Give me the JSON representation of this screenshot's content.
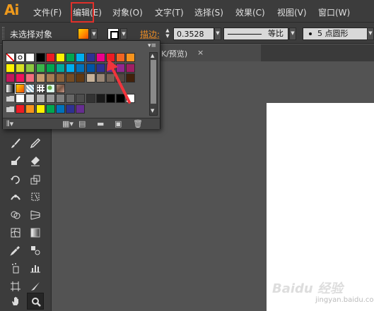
{
  "app": {
    "logo": "Ai"
  },
  "menu": [
    {
      "label": "文件(F)"
    },
    {
      "label": "编辑(E)"
    },
    {
      "label": "对象(O)"
    },
    {
      "label": "文字(T)"
    },
    {
      "label": "选择(S)"
    },
    {
      "label": "效果(C)"
    },
    {
      "label": "视图(V)"
    },
    {
      "label": "窗口(W)"
    }
  ],
  "control": {
    "selection_status": "未选择对象",
    "stroke_label": "描边:",
    "stroke_weight": "0.3528",
    "profile_label": "等比",
    "brush_label": "5 点圆形"
  },
  "document": {
    "tab_label": "K/预览)",
    "close_glyph": "×"
  },
  "swatches": {
    "rows": [
      [
        "none",
        "registration",
        "#ffffff",
        "#000000",
        "#ed1c24",
        "#fff200",
        "#00a651",
        "#00aeef",
        "#2e3192",
        "#ec008c",
        "#ed1c24",
        "#f26522",
        "#f7941d"
      ],
      [
        "#fff200",
        "#d7df23",
        "#8dc63f",
        "#39b54a",
        "#00a651",
        "#00a99d",
        "#00aeef",
        "#0072bc",
        "#0054a6",
        "#2e3192",
        "#662d91",
        "#92278f",
        "#9e1f63"
      ],
      [
        "#c2185b",
        "#ed145b",
        "#f26d7d",
        "#c69c6d",
        "#a67c52",
        "#8c6239",
        "#754c24",
        "#603913",
        "#c7b299",
        "#998675",
        "#736357",
        "#534741",
        "#42210b"
      ],
      [
        "gradient-gray",
        "gradient-orange",
        "pattern-check",
        "pattern-dots",
        "pattern-leaf",
        "pattern-texture"
      ],
      [
        "folder",
        "#ffffff",
        "#d9d9d9",
        "#b3b3b3",
        "#999999",
        "#808080",
        "#666666",
        "#4d4d4d",
        "#333333",
        "#1a1a1a",
        "#000000",
        "#000000",
        "#ffffff"
      ],
      [
        "folder",
        "#ed1c24",
        "#f7941d",
        "#fff200",
        "#00a651",
        "#0072bc",
        "#2e3192",
        "#662d91"
      ]
    ]
  },
  "colors": {
    "accent_orange": "#ef9a1c",
    "highlight_red": "#e0302a",
    "annotation_arrow": "#f0343c",
    "panel_bg": "#535353",
    "chrome_bg": "#3c3c3c"
  },
  "watermark": {
    "brand": "Baidu 经验",
    "url": "jingyan.baidu.com"
  },
  "icons": {
    "tools": [
      "paintbrush-icon",
      "pencil-icon",
      "blob-brush-icon",
      "eraser-icon",
      "rotate-icon",
      "scale-icon",
      "width-icon",
      "free-transform-icon",
      "shape-builder-icon",
      "perspective-grid-icon",
      "mesh-icon",
      "gradient-icon",
      "eyedropper-icon",
      "blend-icon",
      "symbol-sprayer-icon",
      "column-graph-icon",
      "artboard-icon",
      "slice-icon",
      "hand-icon",
      "zoom-icon"
    ]
  }
}
